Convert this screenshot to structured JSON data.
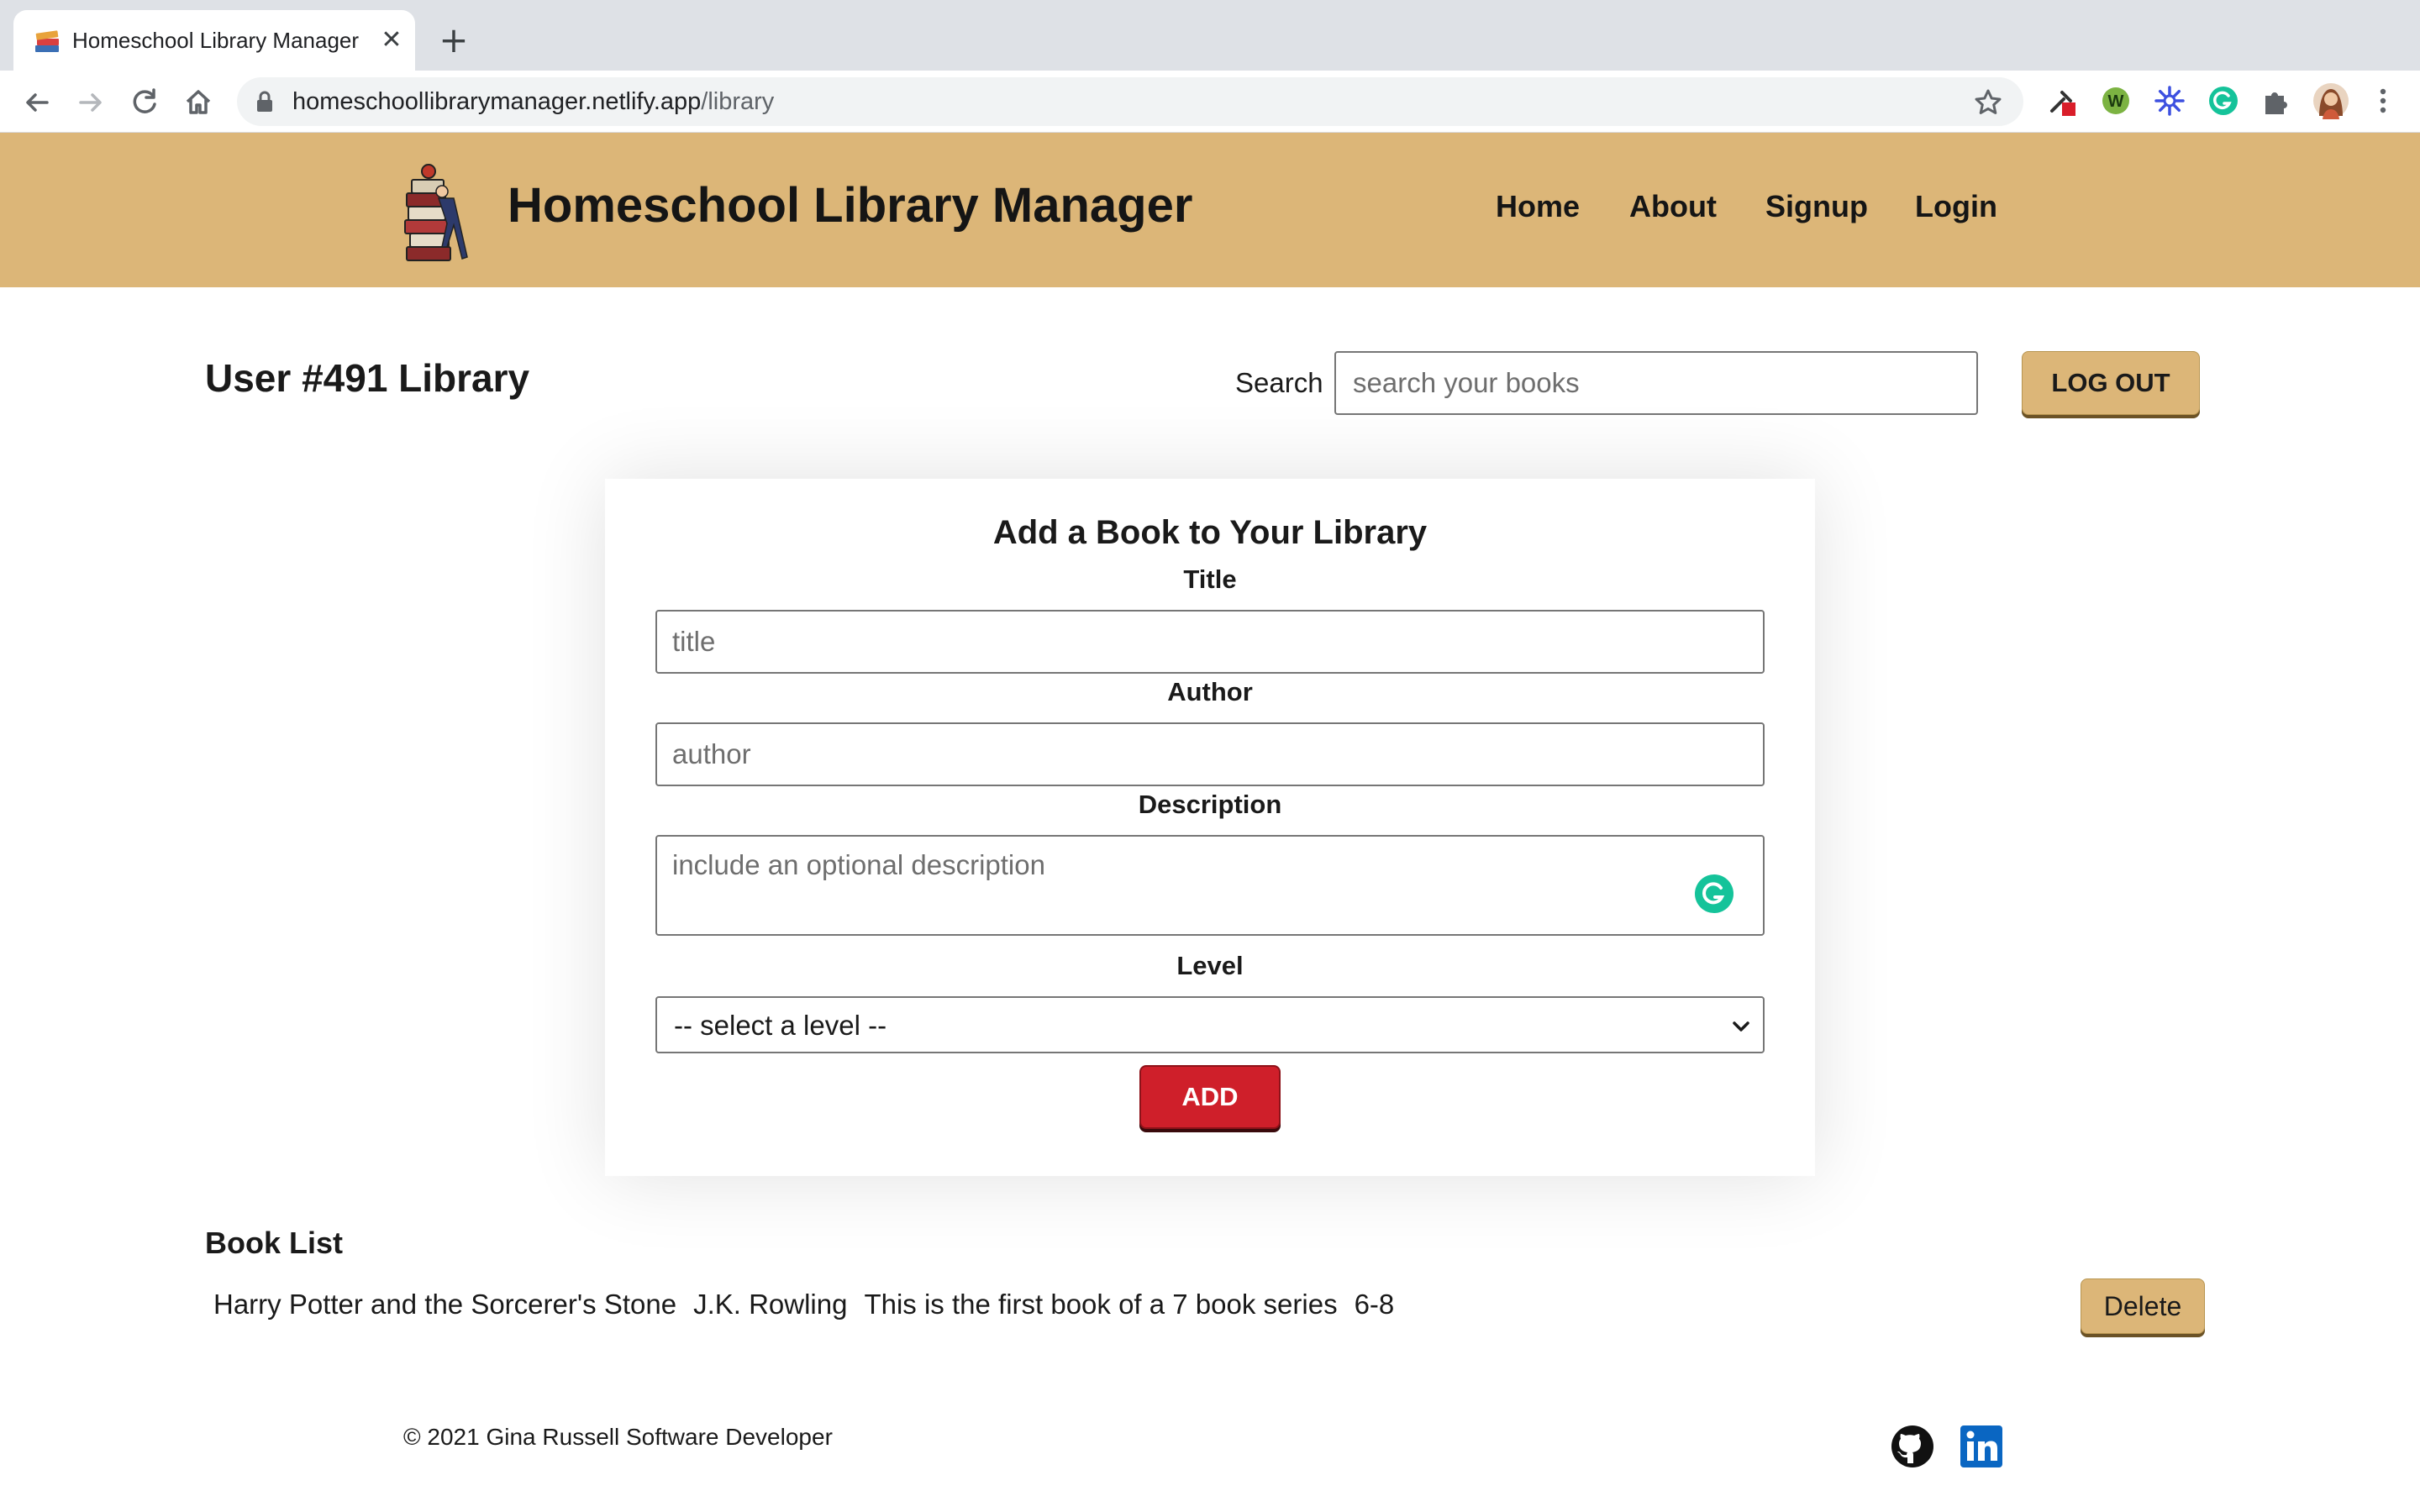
{
  "browser": {
    "tab_title": "Homeschool Library Manager",
    "tab_close": "✕",
    "new_tab": "+",
    "url_host": "homeschoollibrarymanager.netlify.app",
    "url_path": "/library",
    "extension_w_label": "W"
  },
  "header": {
    "site_title": "Homeschool Library Manager",
    "nav": [
      "Home",
      "About",
      "Signup",
      "Login"
    ]
  },
  "main": {
    "library_title": "User #491 Library",
    "search_label": "Search",
    "search_placeholder": "search your books",
    "logout_label": "LOG OUT"
  },
  "form": {
    "heading": "Add a Book to Your Library",
    "title_label": "Title",
    "title_placeholder": "title",
    "author_label": "Author",
    "author_placeholder": "author",
    "description_label": "Description",
    "description_placeholder": "include an optional description",
    "level_label": "Level",
    "level_selected": "-- select a level --",
    "add_label": "ADD"
  },
  "book_list": {
    "heading": "Book List",
    "books": [
      {
        "title": "Harry Potter and the Sorcerer's Stone",
        "author": "J.K. Rowling",
        "description": "This is the first book of a 7 book series",
        "level": "6-8",
        "delete_label": "Delete"
      }
    ]
  },
  "footer": {
    "copyright": "© 2021 Gina Russell Software Developer"
  },
  "icons": {
    "github": "github-icon",
    "linkedin": "linkedin-icon"
  },
  "colors": {
    "header_bg": "#dcb678",
    "add_button": "#cf1f2a",
    "grammarly": "#15c39a",
    "linkedin": "#0a66c2"
  }
}
